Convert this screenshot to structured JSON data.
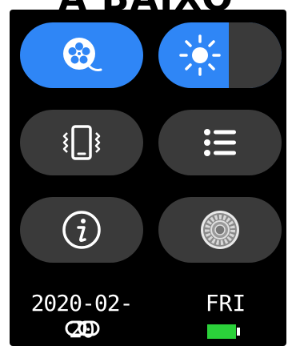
{
  "banner": {
    "text": "A BAIXO"
  },
  "tiles": [
    {
      "icon": "film-reel-icon",
      "state": "active",
      "color": "#2f86f6"
    },
    {
      "icon": "brightness-icon",
      "level": 0.62
    },
    {
      "icon": "vibrate-icon"
    },
    {
      "icon": "list-menu-icon"
    },
    {
      "icon": "info-icon"
    },
    {
      "icon": "settings-gear-icon"
    }
  ],
  "status": {
    "date": "2020-02-20",
    "day": "FRI",
    "link_icon": "link-icon",
    "battery_icon": "battery-icon",
    "battery_level": 1.0,
    "battery_color": "#2bd13a"
  }
}
